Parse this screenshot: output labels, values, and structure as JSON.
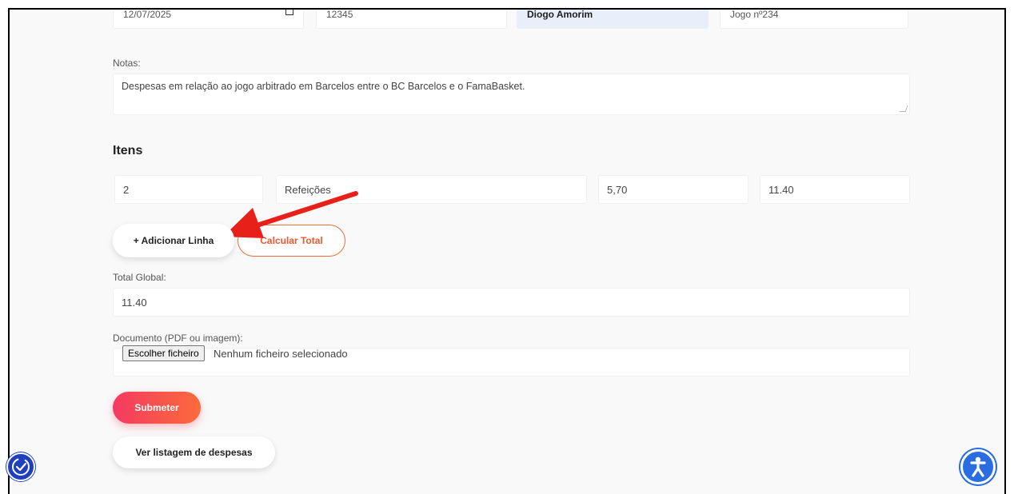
{
  "header_fields": {
    "date": "12/07/2025",
    "number": "12345",
    "name": "Diogo Amorim",
    "reference": "Jogo nº234"
  },
  "notes": {
    "label": "Notas:",
    "value": "Despesas em relação ao jogo arbitrado em Barcelos entre o BC Barcelos e o FamaBasket."
  },
  "items": {
    "title": "Itens",
    "row": {
      "quantity": "2",
      "description": "Refeições",
      "unit_price": "5,70",
      "total": "11.40"
    }
  },
  "buttons": {
    "add_line": "+ Adicionar Linha",
    "calculate_total": "Calcular Total",
    "submit": "Submeter",
    "view_list": "Ver listagem de despesas"
  },
  "total_global": {
    "label": "Total Global:",
    "value": "11.40"
  },
  "document": {
    "label": "Documento (PDF ou imagem):",
    "choose_file": "Escolher ficheiro",
    "status": "Nenhum ficheiro selecionado"
  },
  "icons": {
    "left": "accessibility-check-icon",
    "right": "accessibility-person-icon"
  },
  "colors": {
    "accent": "#f2572e",
    "arrow": "#e8201a",
    "primary_blue": "#2a6de0"
  }
}
